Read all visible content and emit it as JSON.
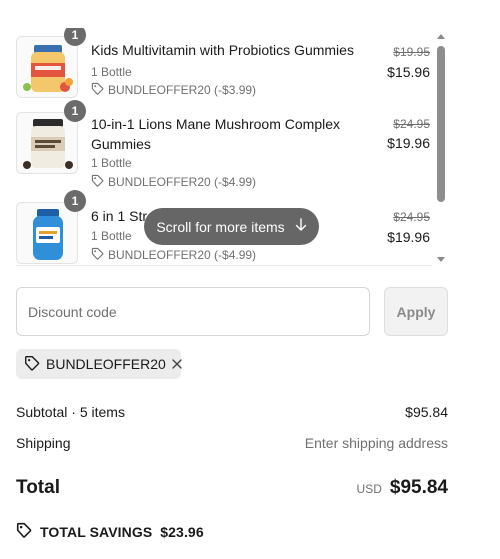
{
  "cart": {
    "items": [
      {
        "quantity": "1",
        "name": "Kids Multivitamin with Probiotics Gummies",
        "variant": "1 Bottle",
        "discount": "BUNDLEOFFER20 (-$3.99)",
        "original_price": "$19.95",
        "price": "$15.96",
        "image_icon": "kids-multivitamin-bottle-icon"
      },
      {
        "quantity": "1",
        "name": "10-in-1 Lions Mane Mushroom Complex Gummies",
        "variant": "1 Bottle",
        "discount": "BUNDLEOFFER20 (-$4.99)",
        "original_price": "$24.95",
        "price": "$19.96",
        "image_icon": "lions-mane-jar-icon"
      },
      {
        "quantity": "1",
        "name": "6 in 1 Stre",
        "variant": "1 Bottle",
        "discount": "BUNDLEOFFER20 (-$4.99)",
        "original_price": "$24.95",
        "price": "$19.96",
        "image_icon": "blue-supplement-bottle-icon"
      }
    ],
    "scroll_hint": "Scroll for more items"
  },
  "discount_form": {
    "placeholder": "Discount code",
    "apply_label": "Apply"
  },
  "applied_code": "BUNDLEOFFER20",
  "summary": {
    "subtotal_label": "Subtotal · 5 items",
    "subtotal_value": "$95.84",
    "shipping_label": "Shipping",
    "shipping_value": "Enter shipping address",
    "total_label": "Total",
    "currency": "USD",
    "total_value": "$95.84",
    "savings_label": "TOTAL SAVINGS",
    "savings_value": "$23.96"
  },
  "colors": {
    "badge": "#6b6b6b",
    "pill": "#666666",
    "muted_text": "#707070"
  }
}
